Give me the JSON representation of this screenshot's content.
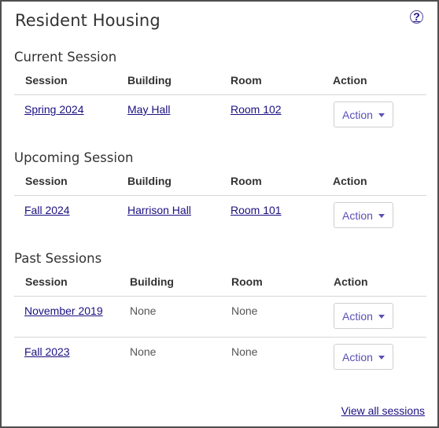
{
  "title": "Resident Housing",
  "help_label": "?",
  "columns": {
    "session": "Session",
    "building": "Building",
    "room": "Room",
    "action": "Action"
  },
  "sections": {
    "current": {
      "title": "Current Session",
      "rows": [
        {
          "session": "Spring 2024",
          "building": "May Hall",
          "room": "Room 102",
          "action": "Action"
        }
      ]
    },
    "upcoming": {
      "title": "Upcoming Session",
      "rows": [
        {
          "session": "Fall 2024",
          "building": "Harrison Hall",
          "room": "Room 101",
          "action": "Action"
        }
      ]
    },
    "past": {
      "title": "Past Sessions",
      "rows": [
        {
          "session": "November 2019",
          "building": "None",
          "room": "None",
          "action": "Action"
        },
        {
          "session": "Fall 2023",
          "building": "None",
          "room": "None",
          "action": "Action"
        }
      ]
    }
  },
  "view_all": "View all sessions",
  "colors": {
    "link": "#1a1080",
    "button_text": "#5a4fb5",
    "border": "#4f4f4f"
  }
}
